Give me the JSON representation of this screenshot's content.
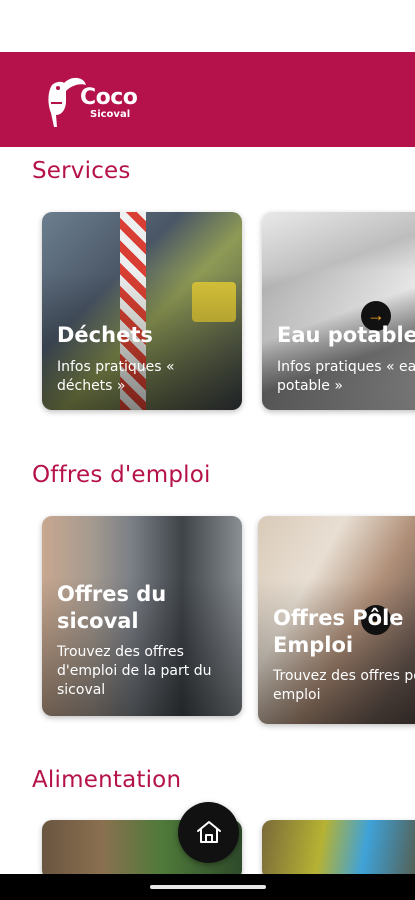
{
  "app": {
    "brand_name": "Coco",
    "brand_sub": "Sicoval",
    "brand_color": "#b5114a"
  },
  "sections": [
    {
      "title": "Services",
      "cards": [
        {
          "title": "Déchets",
          "description": "Infos pratiques « déchets »"
        },
        {
          "title": "Eau potable",
          "description": "Infos pratiques « eau potable »"
        }
      ]
    },
    {
      "title": "Offres d'emploi",
      "cards": [
        {
          "title": "Offres du sicoval",
          "description": "Trouvez des offres d'emploi de la part du sicoval"
        },
        {
          "title": "Offres Pôle Emploi",
          "description": "Trouvez des offres pole emploi"
        }
      ]
    },
    {
      "title": "Alimentation",
      "cards": []
    }
  ],
  "icons": {
    "arrow": "arrow-right-icon",
    "home": "home-icon"
  }
}
